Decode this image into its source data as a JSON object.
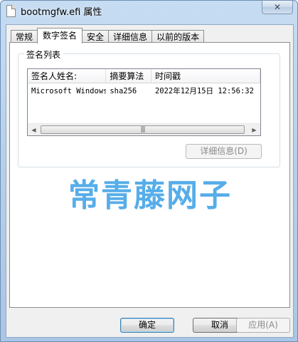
{
  "window": {
    "title": "bootmgfw.efi 属性",
    "close_label": "✕"
  },
  "tabs": [
    {
      "label": "常规",
      "active": false
    },
    {
      "label": "数字签名",
      "active": true
    },
    {
      "label": "安全",
      "active": false
    },
    {
      "label": "详细信息",
      "active": false
    },
    {
      "label": "以前的版本",
      "active": false
    }
  ],
  "signature_list": {
    "group_label": "签名列表",
    "columns": [
      "签名人姓名:",
      "摘要算法",
      "时间戳"
    ],
    "rows": [
      {
        "name": "Microsoft Windows",
        "algorithm": "sha256",
        "timestamp": "2022年12月15日 12:56:32"
      }
    ],
    "scrollbar": {
      "left_arrow": "◀",
      "right_arrow": "▶",
      "thumb_grip": "|||"
    },
    "details_button": "详细信息(D)"
  },
  "watermark": "常青藤网子",
  "footer": {
    "ok": "确定",
    "cancel": "取消",
    "apply": "应用(A)"
  }
}
